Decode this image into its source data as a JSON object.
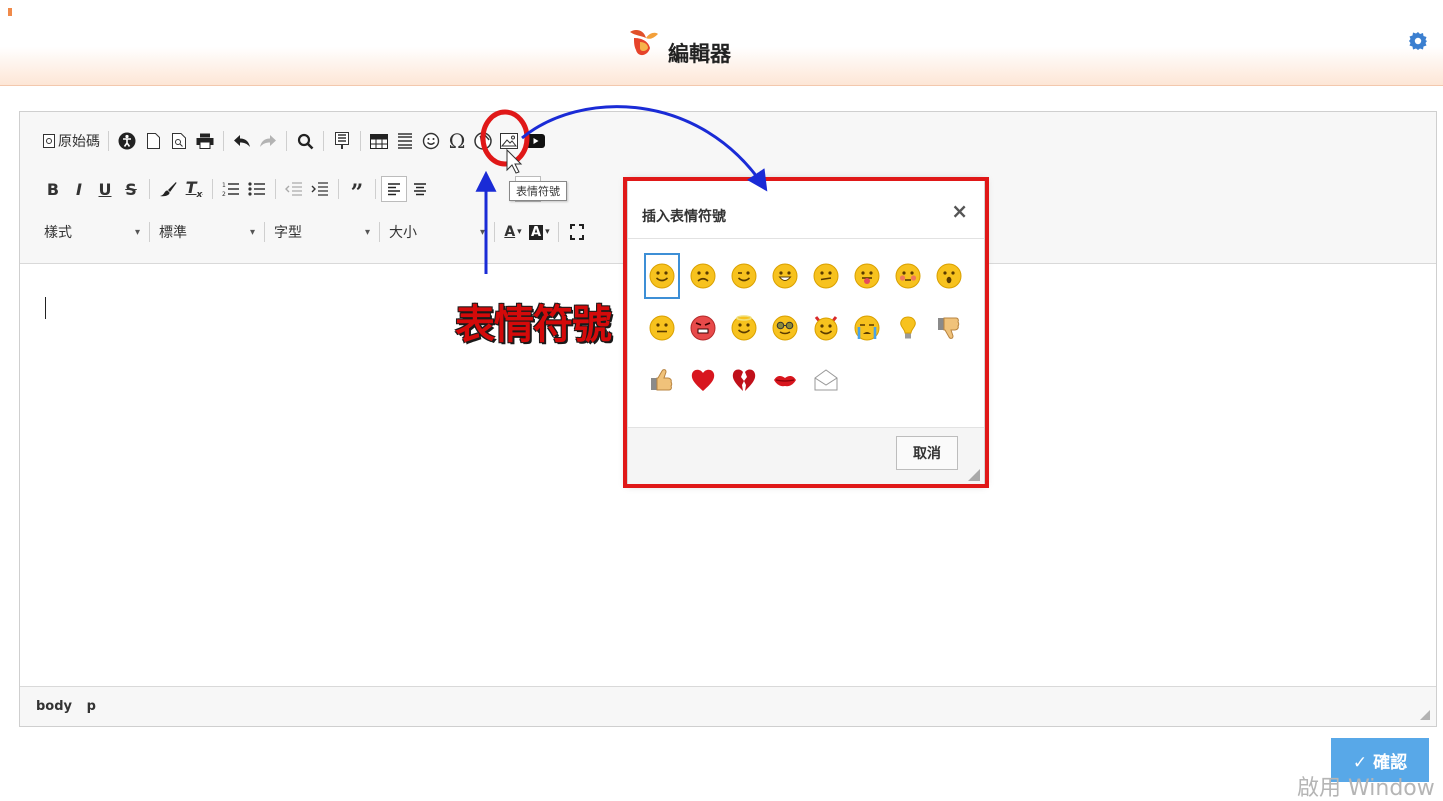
{
  "header": {
    "title": "編輯器",
    "brand_color": "#f08a4a"
  },
  "toolbar": {
    "source_label": "原始碼",
    "combos": [
      {
        "label": "樣式"
      },
      {
        "label": "標準"
      },
      {
        "label": "字型"
      },
      {
        "label": "大小"
      }
    ],
    "tooltip": "表情符號"
  },
  "statusbar": {
    "path": [
      "body",
      "p"
    ]
  },
  "dialog": {
    "title": "插入表情符號",
    "close_label": "×",
    "cancel_label": "取消",
    "emojis": [
      "regular-smile",
      "sad-smile",
      "wink-smile",
      "teeth-smile",
      "confused-smile",
      "tongue-smile",
      "embarrassed-smile",
      "omg-smile",
      "whatchutalkingabout-smile",
      "angry-smile",
      "angel-smile",
      "shades-smile",
      "devil-smile",
      "cry-smile",
      "lightbulb",
      "thumbs-down",
      "thumbs-up",
      "heart",
      "broken-heart",
      "kiss",
      "envelope"
    ],
    "selected_index": 0
  },
  "annotation": {
    "label": "表情符號",
    "color": "#d40a0a",
    "arrow_color": "#1a2bd6"
  },
  "footer": {
    "confirm_label": "✓ 確認",
    "watermark": "啟用 Window"
  },
  "colors": {
    "accent": "#58a8e8",
    "highlight": "#e01818"
  }
}
